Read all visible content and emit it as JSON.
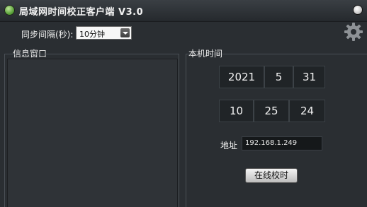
{
  "window": {
    "title": "局域网时间校正客户端 V3.0"
  },
  "settings": {
    "interval_label": "同步间隔(秒):",
    "interval_value": "10分钟"
  },
  "sections": {
    "info_label": "信息窗口",
    "time_label": "本机时间"
  },
  "time": {
    "year": "2021",
    "month": "5",
    "day": "31",
    "hour": "10",
    "minute": "25",
    "second": "24"
  },
  "address": {
    "label": "地址",
    "value": "192.168.1.249"
  },
  "actions": {
    "sync_label": "在线校时"
  },
  "icons": {
    "app": "app-icon",
    "close": "close-icon",
    "settings": "gear-icon",
    "dropdown": "chevron-down-icon"
  }
}
